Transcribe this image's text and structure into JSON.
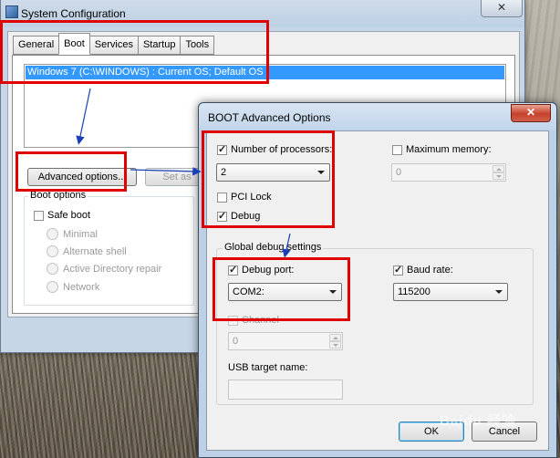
{
  "system_config": {
    "title": "System Configuration",
    "close_glyph": "✕",
    "tabs": [
      {
        "label": "General"
      },
      {
        "label": "Boot"
      },
      {
        "label": "Services"
      },
      {
        "label": "Startup"
      },
      {
        "label": "Tools"
      }
    ],
    "active_tab": "Boot",
    "os_entries": [
      "Windows 7 (C:\\WINDOWS) : Current OS; Default OS"
    ],
    "advanced_button": "Advanced options...",
    "set_default_button": "Set as",
    "boot_options": {
      "label": "Boot options",
      "safe_boot": "Safe boot",
      "safe_boot_checked": false,
      "radio_items": [
        "Minimal",
        "Alternate shell",
        "Active Directory repair",
        "Network"
      ]
    }
  },
  "advanced_dialog": {
    "title": "BOOT Advanced Options",
    "close_glyph": "✕",
    "num_processors": {
      "label": "Number of processors:",
      "checked": true,
      "value": "2"
    },
    "max_memory": {
      "label": "Maximum memory:",
      "checked": false,
      "value": "0"
    },
    "pci_lock": {
      "label": "PCI Lock",
      "checked": false
    },
    "debug": {
      "label": "Debug",
      "checked": true
    },
    "global_debug": {
      "label": "Global debug settings",
      "debug_port": {
        "label": "Debug port:",
        "checked": true,
        "value": "COM2:"
      },
      "baud_rate": {
        "label": "Baud rate:",
        "checked": true,
        "value": "115200"
      },
      "channel": {
        "label": "Channel",
        "checked": false,
        "value": "0"
      },
      "usb_target": {
        "label": "USB target name:",
        "value": ""
      }
    },
    "ok_button": "OK",
    "cancel_button": "Cancel"
  },
  "annotation_color": "#e00000",
  "watermark": "Baidu 经验"
}
